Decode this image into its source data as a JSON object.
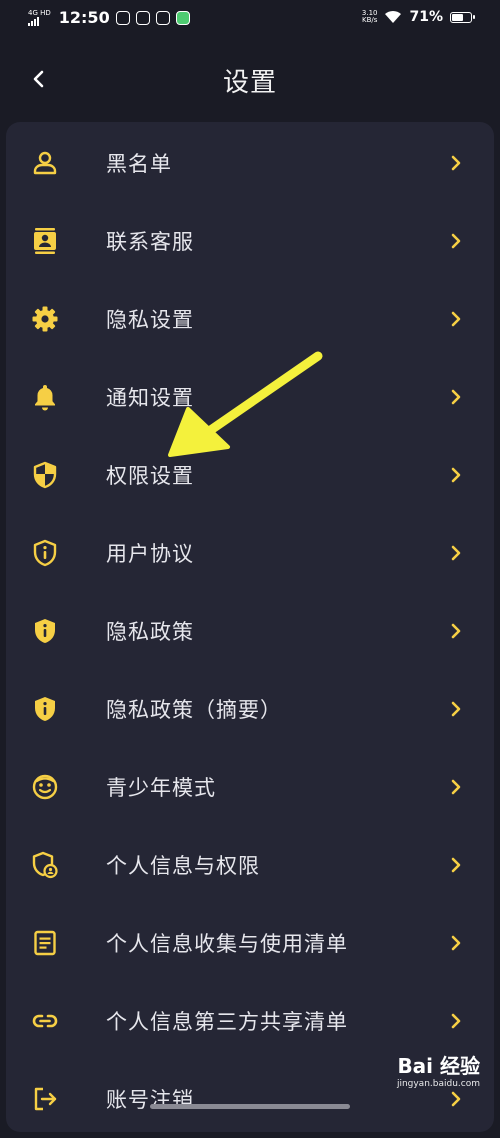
{
  "status_bar": {
    "network": "4G HD",
    "time": "12:50",
    "net_speed": "3.10",
    "net_speed_unit": "KB/s",
    "battery_percent": "71%",
    "battery_level": 0.71
  },
  "header": {
    "title": "设置",
    "back_icon": "chevron-left-icon"
  },
  "colors": {
    "background": "#1a1b25",
    "panel": "#252635",
    "accent": "#f6cf45",
    "text": "#e6e6ec",
    "annotation_arrow": "#f4f13c"
  },
  "menu": {
    "items": [
      {
        "label": "黑名单",
        "icon": "person-icon"
      },
      {
        "label": "联系客服",
        "icon": "contact-card-icon"
      },
      {
        "label": "隐私设置",
        "icon": "gear-icon"
      },
      {
        "label": "通知设置",
        "icon": "bell-icon"
      },
      {
        "label": "权限设置",
        "icon": "shield-icon"
      },
      {
        "label": "用户协议",
        "icon": "info-shield-outline-icon"
      },
      {
        "label": "隐私政策",
        "icon": "info-shield-icon"
      },
      {
        "label": "隐私政策（摘要）",
        "icon": "info-shield-icon"
      },
      {
        "label": "青少年模式",
        "icon": "smiley-icon"
      },
      {
        "label": "个人信息与权限",
        "icon": "shield-person-icon"
      },
      {
        "label": "个人信息收集与使用清单",
        "icon": "document-list-icon"
      },
      {
        "label": "个人信息第三方共享清单",
        "icon": "link-icon"
      },
      {
        "label": "账号注销",
        "icon": "logout-icon"
      }
    ]
  },
  "watermark": {
    "logo": "Bai 经验",
    "url": "jingyan.baidu.com"
  }
}
